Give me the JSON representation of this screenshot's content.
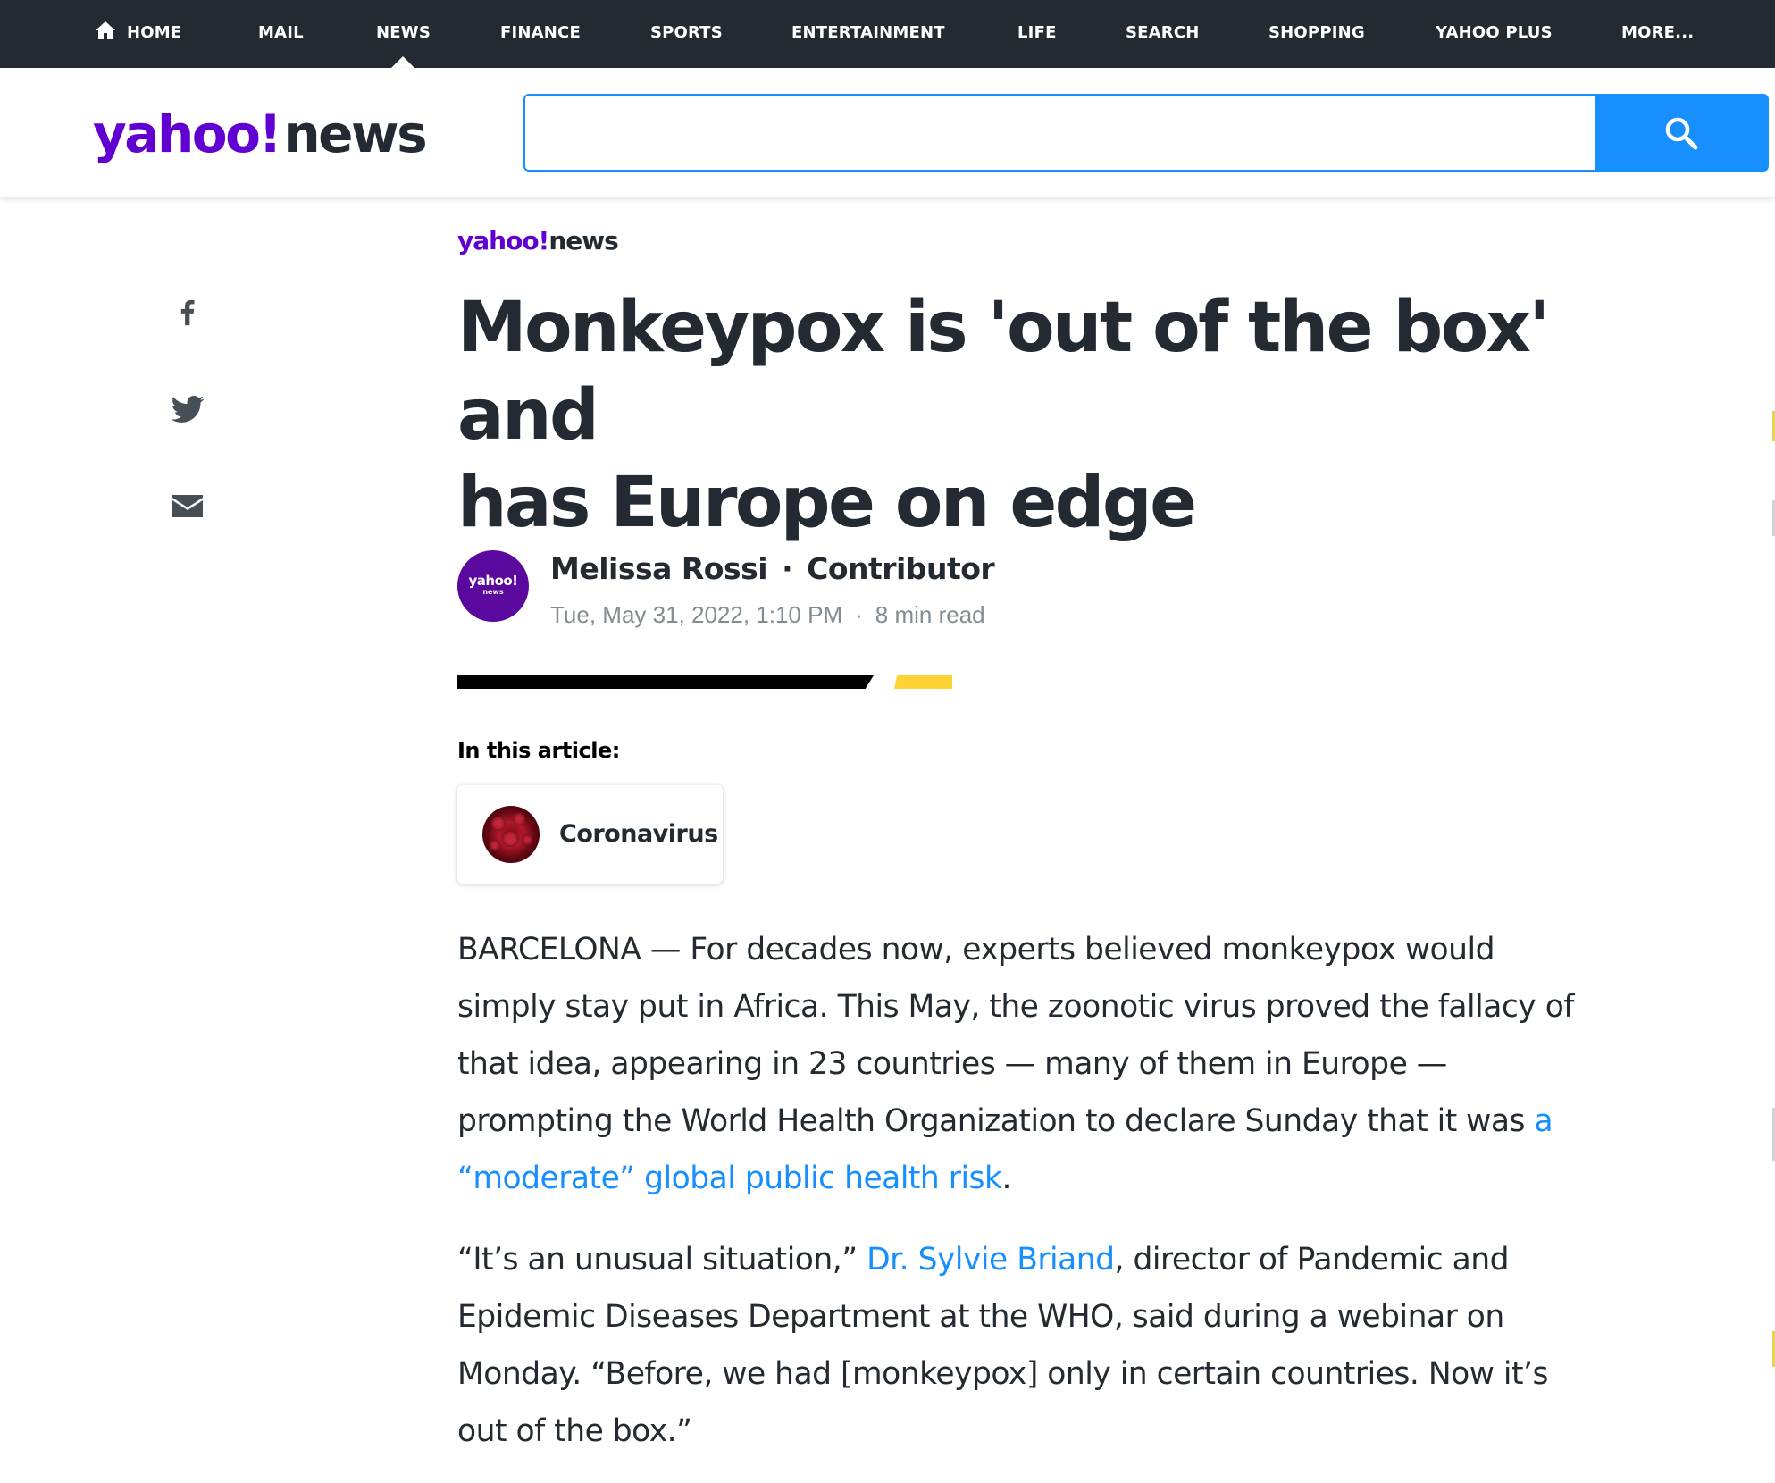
{
  "topnav": {
    "items": [
      {
        "label": "HOME",
        "icon": "home-icon"
      },
      {
        "label": "MAIL"
      },
      {
        "label": "NEWS",
        "active": true
      },
      {
        "label": "FINANCE"
      },
      {
        "label": "SPORTS"
      },
      {
        "label": "ENTERTAINMENT"
      },
      {
        "label": "LIFE"
      },
      {
        "label": "SEARCH"
      },
      {
        "label": "SHOPPING"
      },
      {
        "label": "YAHOO PLUS"
      },
      {
        "label": "MORE..."
      }
    ]
  },
  "header": {
    "logo_yahoo": "yahoo!",
    "logo_news": "news",
    "search_value": "",
    "search_icon": "search-icon"
  },
  "share": {
    "icons": [
      "facebook-icon",
      "twitter-icon",
      "mail-icon"
    ]
  },
  "article": {
    "source_logo_yahoo": "yahoo!",
    "source_logo_news": "news",
    "headline_line1": "Monkeypox is 'out of the box' and",
    "headline_line2": "has Europe on edge",
    "avatar_line1": "yahoo!",
    "avatar_line2": "news",
    "author": "Melissa Rossi",
    "author_dot": "·",
    "author_role": "Contributor",
    "date": "Tue, May 31, 2022, 1:10 PM",
    "meta_dot": "·",
    "read_time": "8 min read",
    "in_this_article": "In this article:",
    "topic": "Coronavirus",
    "p1_text1": "BARCELONA — For decades now, experts believed monkeypox would simply stay put in Africa. This May, the zoonotic virus proved the fallacy of that idea, appearing in 23 countries — many of them in Europe —prompting the World Health Organization to declare Sunday that it was ",
    "p1_link": "a “moderate” global public health risk",
    "p1_text2": ".",
    "p2_text1": "“It’s an unusual situation,” ",
    "p2_link": "Dr. Sylvie Briand",
    "p2_text2": ", director of Pandemic and Epidemic Diseases Department at the WHO, said during a webinar on Monday. “Before, we had [monkeypox] only in certain countries. Now it’s out of the box.”"
  },
  "colors": {
    "nav_bg": "#232a31",
    "brand_purple": "#6001d2",
    "search_blue": "#188fff",
    "link_blue": "#188fff",
    "accent_yellow": "#ffd333",
    "meta_gray": "#828c93"
  }
}
